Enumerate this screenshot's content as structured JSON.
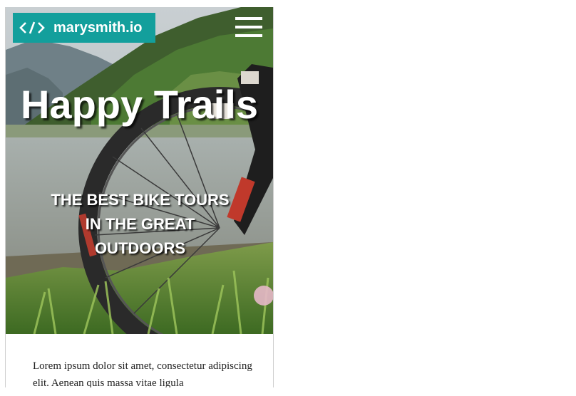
{
  "header": {
    "logo_text": "marysmith.io",
    "logo_icon": "code-brackets-icon",
    "menu_icon": "hamburger-menu-icon"
  },
  "hero": {
    "title": "Happy Trails",
    "subtitle": "THE BEST BIKE TOURS IN THE GREAT OUTDOORS",
    "background_image": "mountain-bike-by-lake-photo"
  },
  "content": {
    "paragraph": "Lorem ipsum dolor sit amet, consectetur adipiscing elit. Aenean quis massa vitae ligula"
  },
  "colors": {
    "brand": "#139f9c",
    "hero_text": "#ffffff",
    "body_text": "#222222"
  }
}
